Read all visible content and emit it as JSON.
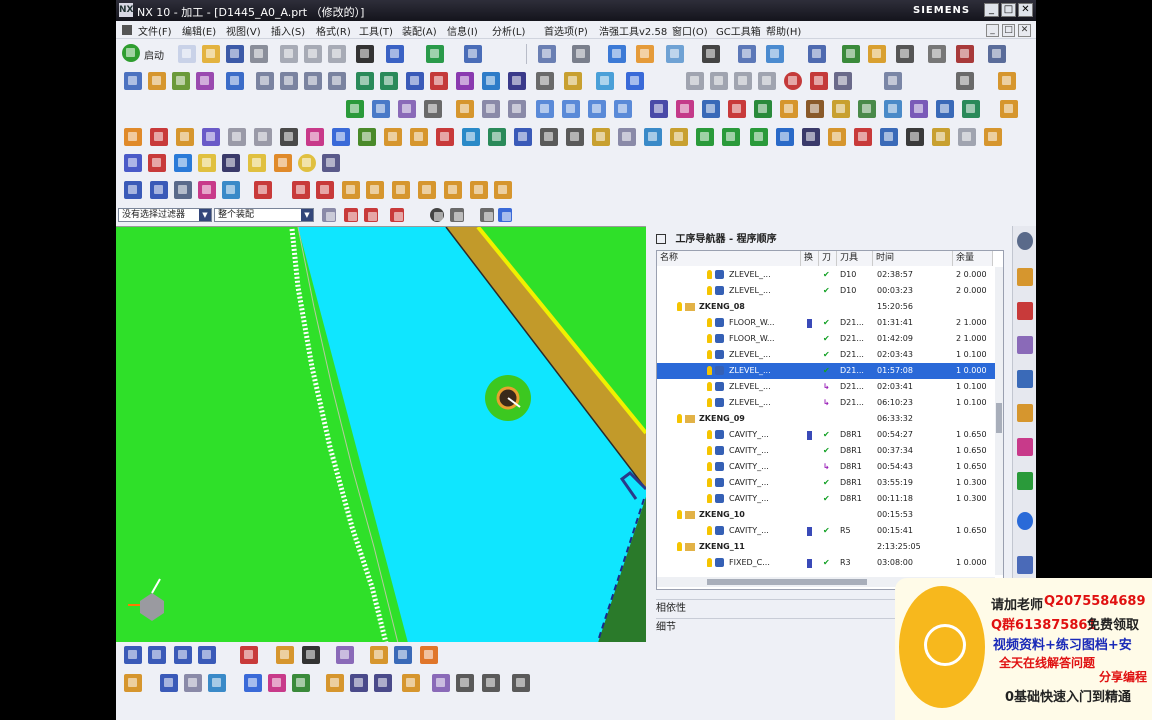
{
  "window": {
    "title": "NX 10 - 加工 - [D1445_A0_A.prt （修改的）]",
    "brand": "SIEMENS",
    "buttons": [
      "_",
      "□",
      "✕"
    ],
    "mdi_buttons": [
      "_",
      "□",
      "✕"
    ]
  },
  "menu": [
    "文件(F)",
    "编辑(E)",
    "视图(V)",
    "插入(S)",
    "格式(R)",
    "工具(T)",
    "装配(A)",
    "信息(I)",
    "分析(L)",
    "首选项(P)",
    "浩强工具v2.58",
    "窗口(O)",
    "GC工具箱",
    "帮助(H)"
  ],
  "toolbar": {
    "start_label": "启动"
  },
  "filter": {
    "selection_filter": "没有选择过滤器",
    "assembly_scope": "整个装配"
  },
  "navigator": {
    "title": "工序导航器 - 程序顺序",
    "columns": [
      "名称",
      "换",
      "刀",
      "刀具",
      "时间",
      "余量"
    ],
    "rows": [
      {
        "name": "ZLEVEL_...",
        "kind": "op",
        "level": 3,
        "tc": false,
        "status": "check",
        "tool": "D10",
        "time": "02:38:57",
        "stock": "2 0.000"
      },
      {
        "name": "ZLEVEL_...",
        "kind": "op",
        "level": 3,
        "tc": false,
        "status": "check",
        "tool": "D10",
        "time": "00:03:23",
        "stock": "2 0.000"
      },
      {
        "name": "ZKENG_08",
        "kind": "group",
        "level": 2,
        "tc": false,
        "status": "",
        "tool": "",
        "time": "15:20:56",
        "stock": ""
      },
      {
        "name": "FLOOR_W...",
        "kind": "op",
        "level": 3,
        "tc": true,
        "status": "check",
        "tool": "D21...",
        "time": "01:31:41",
        "stock": "2 1.000"
      },
      {
        "name": "FLOOR_W...",
        "kind": "op",
        "level": 3,
        "tc": false,
        "status": "check",
        "tool": "D21...",
        "time": "01:42:09",
        "stock": "2 1.000"
      },
      {
        "name": "ZLEVEL_...",
        "kind": "op",
        "level": 3,
        "tc": false,
        "status": "check",
        "tool": "D21...",
        "time": "02:03:43",
        "stock": "1 0.100"
      },
      {
        "name": "ZLEVEL_...",
        "kind": "op",
        "level": 3,
        "tc": false,
        "status": "check",
        "tool": "D21...",
        "time": "01:57:08",
        "stock": "1 0.000",
        "selected": true
      },
      {
        "name": "ZLEVEL_...",
        "kind": "op",
        "level": 3,
        "tc": false,
        "status": "regen",
        "tool": "D21...",
        "time": "02:03:41",
        "stock": "1 0.100"
      },
      {
        "name": "ZLEVEL_...",
        "kind": "op",
        "level": 3,
        "tc": false,
        "status": "regen",
        "tool": "D21...",
        "time": "06:10:23",
        "stock": "1 0.100"
      },
      {
        "name": "ZKENG_09",
        "kind": "group",
        "level": 2,
        "tc": false,
        "status": "",
        "tool": "",
        "time": "06:33:32",
        "stock": ""
      },
      {
        "name": "CAVITY_...",
        "kind": "op",
        "level": 3,
        "tc": true,
        "status": "check",
        "tool": "D8R1",
        "time": "00:54:27",
        "stock": "1 0.650"
      },
      {
        "name": "CAVITY_...",
        "kind": "op",
        "level": 3,
        "tc": false,
        "status": "check",
        "tool": "D8R1",
        "time": "00:37:34",
        "stock": "1 0.650"
      },
      {
        "name": "CAVITY_...",
        "kind": "op",
        "level": 3,
        "tc": false,
        "status": "regen",
        "tool": "D8R1",
        "time": "00:54:43",
        "stock": "1 0.650"
      },
      {
        "name": "CAVITY_...",
        "kind": "op",
        "level": 3,
        "tc": false,
        "status": "check",
        "tool": "D8R1",
        "time": "03:55:19",
        "stock": "1 0.300"
      },
      {
        "name": "CAVITY_...",
        "kind": "op",
        "level": 3,
        "tc": false,
        "status": "check",
        "tool": "D8R1",
        "time": "00:11:18",
        "stock": "1 0.300"
      },
      {
        "name": "ZKENG_10",
        "kind": "group",
        "level": 2,
        "tc": false,
        "status": "",
        "tool": "",
        "time": "00:15:53",
        "stock": ""
      },
      {
        "name": "CAVITY_...",
        "kind": "op",
        "level": 3,
        "tc": true,
        "status": "check",
        "tool": "R5",
        "time": "00:15:41",
        "stock": "1 0.650"
      },
      {
        "name": "ZKENG_11",
        "kind": "group",
        "level": 2,
        "tc": false,
        "status": "",
        "tool": "",
        "time": "2:13:25:05",
        "stock": ""
      },
      {
        "name": "FIXED_C...",
        "kind": "op",
        "level": 3,
        "tc": true,
        "status": "check",
        "tool": "R3",
        "time": "03:08:00",
        "stock": "1 0.000"
      }
    ]
  },
  "panels": {
    "dependencies": "相依性",
    "details": "细节"
  },
  "ad": {
    "line1a": "请加老师",
    "line1b": "Q2075584689",
    "line2a": "Q群613875861",
    "line2b": "免费领取",
    "line3": "视频资料+练习图档+安",
    "line4": "全天在线解答问题",
    "line5": "分享编程",
    "line6": "0基础快速入门到精通"
  },
  "colors": {
    "viewport_green": "#2fe029",
    "cavity_cyan": "#0fe6ff",
    "wall_brown": "#c29a2a",
    "rim_yellow": "#f0f000",
    "highlight": "#2a69d8",
    "ad_orange": "#f7b81d"
  }
}
